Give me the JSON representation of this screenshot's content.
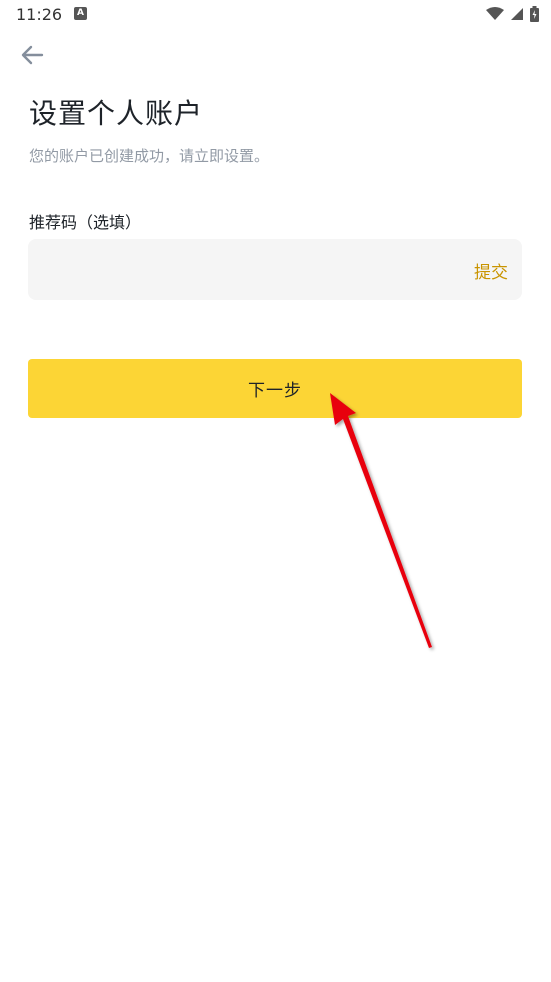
{
  "status_bar": {
    "time": "11:26",
    "notification_icon": "A",
    "icons": [
      "wifi-icon",
      "signal-icon",
      "battery-icon"
    ]
  },
  "header": {
    "back_icon": "arrow-left-icon"
  },
  "main": {
    "title": "设置个人账户",
    "subtitle": "您的账户已创建成功，请立即设置。",
    "referral_label": "推荐码（选填）",
    "referral_value": "",
    "submit_label": "提交",
    "next_label": "下一步"
  },
  "colors": {
    "accent": "#fcd535",
    "link": "#c99400",
    "input_bg": "#f5f5f5",
    "subtitle": "#929aa5",
    "annotation_arrow": "#e8000f"
  }
}
